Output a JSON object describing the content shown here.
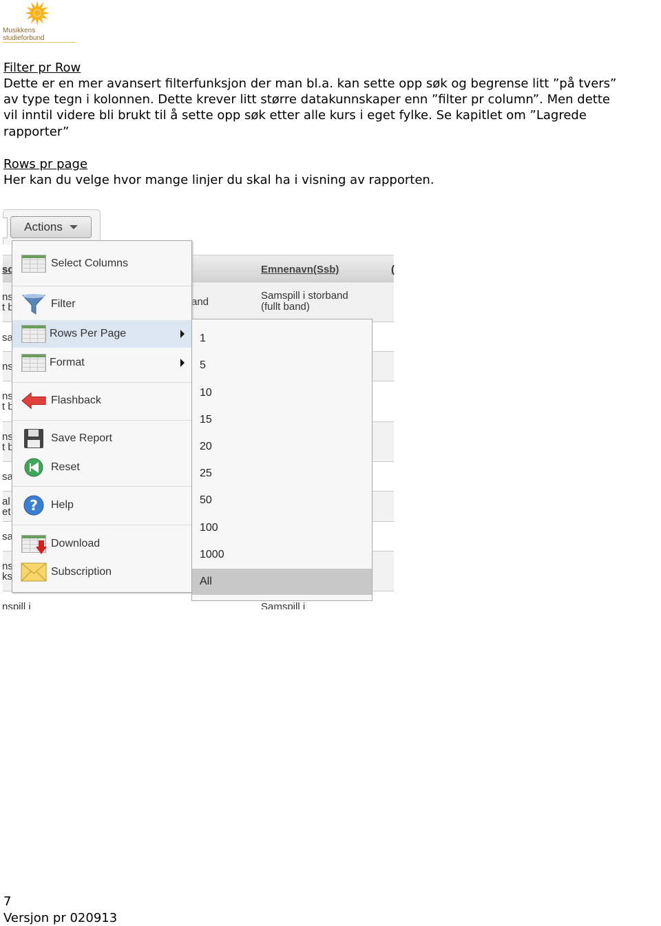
{
  "logo": {
    "text": "Musikkens studieforbund",
    "sun_color": "#f5b21e"
  },
  "section1": {
    "heading": "Filter pr Row",
    "lines": [
      "Dette er en mer avansert filterfunksjon der man bl.a. kan sette opp søk og begrense litt ”på tvers”",
      "av type tegn i kolonnen. Dette krever litt større datakunnskaper enn ”filter pr column”. Men dette",
      "vil inntil videre bli brukt til å sette opp søk etter alle kurs i eget fylke. Se kapitlet om ”Lagrede",
      "rapporter”"
    ]
  },
  "section2": {
    "heading": "Rows pr page",
    "lines": [
      "Her kan du velge hvor mange linjer du skal ha i visning av rapporten."
    ]
  },
  "screenshot": {
    "actions_label": "Actions",
    "table": {
      "header_left": "sc",
      "header_col": "Emnenavn(Ssb)",
      "header_right": "(",
      "row1_mid": "and",
      "row1_col": "Samspill i storband",
      "row1_col2": "(fullt band)",
      "bottom_left": "nspill i",
      "bottom_col": "Samspill i",
      "left_fragments": [
        "ns\nt b",
        "sa",
        "ns",
        "ns\nt b",
        "ns\nt b",
        "sa",
        "al\net",
        "sa",
        "ns\nks"
      ]
    },
    "menu": [
      {
        "label": "Select Columns",
        "icon": "select-columns-icon"
      },
      {
        "label": "Filter",
        "icon": "filter-funnel-icon"
      },
      {
        "label": "Rows Per Page",
        "icon": "rows-per-page-icon",
        "submenu": true,
        "highlighted": true
      },
      {
        "label": "Format",
        "icon": "format-icon",
        "submenu": true
      },
      {
        "label": "Flashback",
        "icon": "flashback-arrow-icon"
      },
      {
        "label": "Save Report",
        "icon": "floppy-disk-icon"
      },
      {
        "label": "Reset",
        "icon": "reset-icon"
      },
      {
        "label": "Help",
        "icon": "help-icon"
      },
      {
        "label": "Download",
        "icon": "download-icon"
      },
      {
        "label": "Subscription",
        "icon": "envelope-icon"
      }
    ],
    "rows_options": [
      "1",
      "5",
      "10",
      "15",
      "20",
      "25",
      "50",
      "100",
      "1000",
      "All"
    ],
    "selected_option": "All"
  },
  "footer": {
    "page_number": "7",
    "version": "Versjon pr 020913"
  }
}
